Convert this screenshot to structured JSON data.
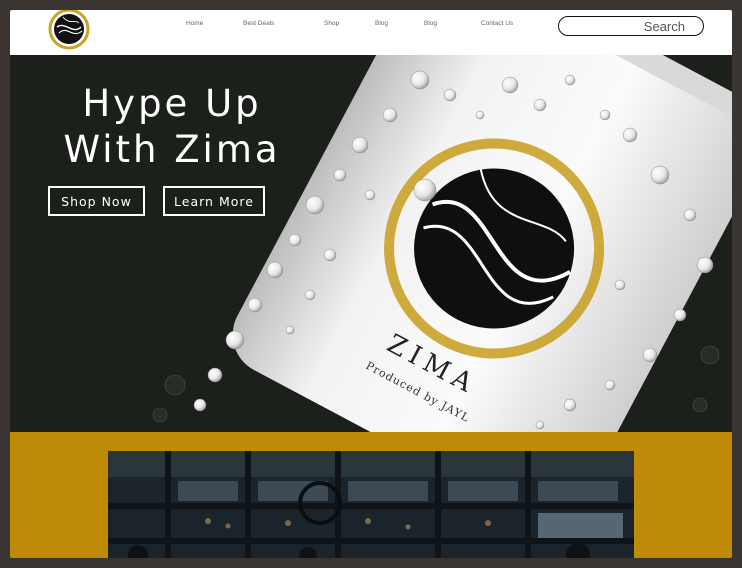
{
  "nav": {
    "items": [
      {
        "label": "Home"
      },
      {
        "label": "Best Deals"
      },
      {
        "label": "Shop"
      },
      {
        "label": "Blog"
      },
      {
        "label": "Blog"
      },
      {
        "label": "Contact Us"
      }
    ]
  },
  "search": {
    "placeholder": "Search"
  },
  "hero": {
    "title": "Hype Up\nWith Zima",
    "shop_now": "Shop Now",
    "learn_more": "Learn More",
    "can_brand": "ZIMA",
    "can_tagline": "Produced by JAYL"
  },
  "colors": {
    "brand_gold": "#bf8b07",
    "hero_dark": "#1c201b",
    "header_bg": "#ffffff"
  },
  "icons": {
    "logo": "zima-swirl-logo",
    "search": "search-field"
  }
}
